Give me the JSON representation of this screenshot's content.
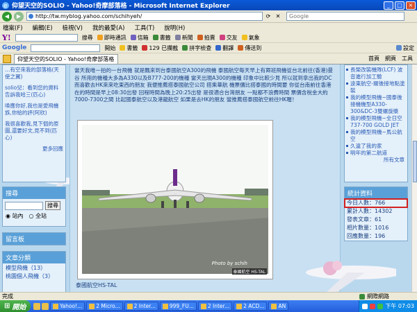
{
  "window": {
    "title": "仰望天空的SOLIO - Yahoo!奇摩部落格 - Microsoft Internet Explorer",
    "address": "http://tw.myblog.yahoo.com/schihyeh/",
    "search_placeholder": "Google"
  },
  "menubar": [
    "檔案(F)",
    "編輯(E)",
    "檢視(V)",
    "我的最愛(A)",
    "工具(T)",
    "說明(H)"
  ],
  "yahoo_toolbar": {
    "logo": "Y!",
    "search_label": "搜尋",
    "items": [
      "即時通訊",
      "信箱",
      "書籤",
      "新聞",
      "拍賣",
      "交友",
      "氣象"
    ]
  },
  "google_toolbar": {
    "logo": "Google",
    "items": [
      "開始",
      "書籤",
      "129 已攔截",
      "拼字檢查",
      "翻譯",
      "傳送到"
    ],
    "settings": "設定"
  },
  "tab": {
    "title": "仰望天空的SOLIO - Yahoo!奇摩部落格"
  },
  "tab_tools": [
    "首頁",
    "網頁",
    "工具"
  ],
  "left_col": {
    "top_links": [
      "…有空來我的部落格(天使之翼)",
      "solio兒：看到您的資料告訴我哈三(匹心)",
      "喚應你好,我也是愛飛機族,你給的評(阿欣)",
      "我很喜歡我,見下個的原圖,還要好文,見不到(匹心)"
    ],
    "more": "更多回應",
    "search_title": "搜尋",
    "search_button": "搜尋",
    "radio_site": "站內",
    "radio_all": "全站",
    "links_box": "留言板",
    "category_title": "文章分類",
    "categories": [
      "模型飛機（13）",
      "桃園個人飛機（3）"
    ]
  },
  "main": {
    "story": "當天我唯一拍的一台飛機 就是飄來到台泰國航空A300的飛機 泰國航空每天早上有兩班飛機從台北前往(香港)曼谷 所用的機種大多為A330以及B777-200的機種 當天出現A300的機種 印象中比較少見 所以就到拿出我的DC 而喜歡去HK來來吃東西的朋友 我便推薦搭泰國航空公司 搭乘華航 機票價比搭泰國的時間要 你從台南前往香港 在的時間是早上08:30出發 回程時間為晚上20:25出發 是很適合台灣朋友 一點都不浪費時間 票價含稅金大約7000-7300之間 比起國泰航空以及港龍航空 如果是去HK的朋友 蠻推薦搭泰國航空前往HK喔！",
    "photo_credit": "Photo by schih",
    "photo_watermark": "泰國航空 HS-TAL",
    "caption": "泰國航空HS-TAL"
  },
  "right_col": {
    "links": [
      "長榮改裝機隊(LCF) 波音進行加工驗",
      "遠東航空-關後接地點塗裝",
      "我的模型飛機~國泰後接機機型A330-300&DC-3雙螺旋槳",
      "我的模型飛機~全日空737-700 GOLD JET",
      "我的模型飛機~馬公航空",
      "久違了我的家",
      "明年的第二航道"
    ],
    "more": "所有文章",
    "stats_title": "統計資料",
    "stats": [
      "今日人數：766",
      "累計人數：14302",
      "發表文章：61",
      "相片數量：1016",
      "回應數量：196"
    ]
  },
  "status": {
    "left": "完成",
    "zone": "網際網路"
  },
  "taskbar": {
    "start": "開始",
    "buttons": [
      "Yahoo!...",
      "2 Micro...",
      "2 Inter...",
      "999_FU...",
      "2 Inter...",
      "2 ACD...",
      "AN"
    ],
    "time": "下午 07:03"
  },
  "colors": {
    "accent": "#5aa0d8",
    "stats_highlight": "#d21f1f",
    "page_bg": "#b9d8ee"
  }
}
